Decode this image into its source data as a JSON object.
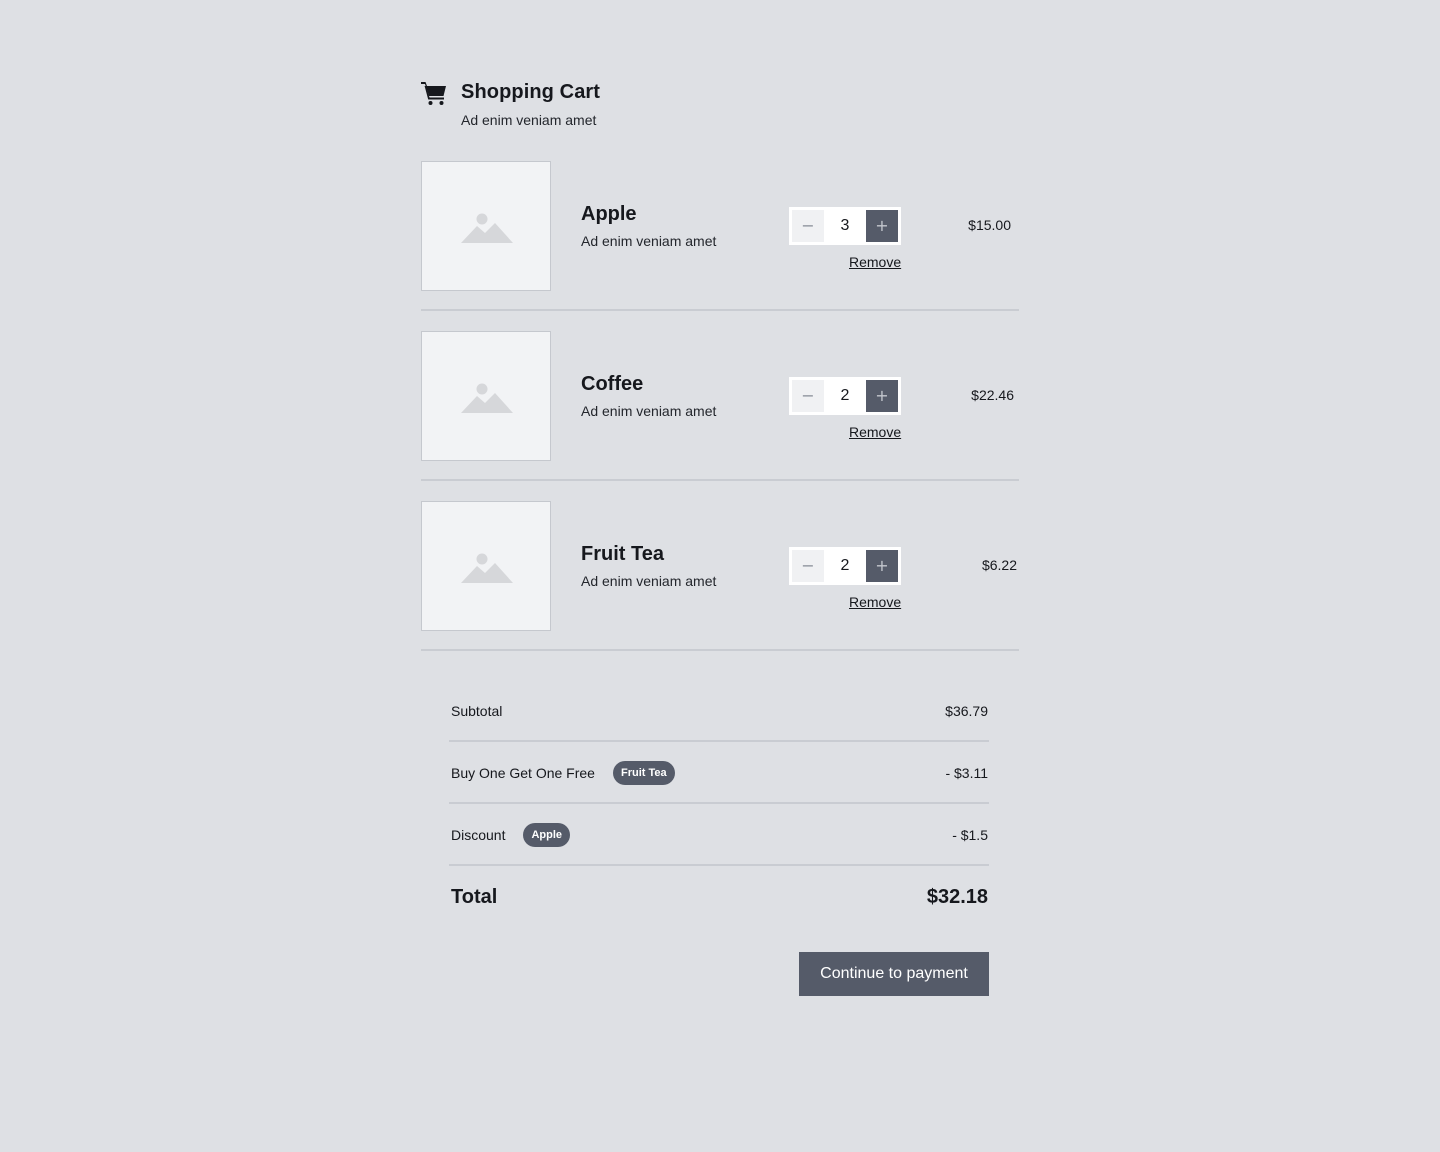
{
  "header": {
    "title": "Shopping Cart",
    "subtitle": "Ad enim veniam amet"
  },
  "items": [
    {
      "name": "Apple",
      "description": "Ad enim veniam amet",
      "quantity": "3",
      "price": "$15.00",
      "remove_label": "Remove",
      "decrement": "−",
      "increment": "+"
    },
    {
      "name": "Coffee",
      "description": "Ad enim veniam amet",
      "quantity": "2",
      "price": "$22.46",
      "remove_label": "Remove",
      "decrement": "−",
      "increment": "+"
    },
    {
      "name": "Fruit Tea",
      "description": "Ad enim veniam amet",
      "quantity": "2",
      "price": "$6.22",
      "remove_label": "Remove",
      "decrement": "−",
      "increment": "+"
    }
  ],
  "summary": {
    "subtotal_label": "Subtotal",
    "subtotal_value": "$36.79",
    "bogo_label": "Buy One Get One Free",
    "bogo_badge": "Fruit Tea",
    "bogo_value": "- $3.11",
    "discount_label": "Discount",
    "discount_badge": "Apple",
    "discount_value": "- $1.5",
    "total_label": "Total",
    "total_value": "$32.18"
  },
  "actions": {
    "pay_label": "Continue to payment"
  },
  "icons": {
    "cart": "shopping-cart-icon",
    "thumbnail": "image-placeholder-icon"
  },
  "colors": {
    "background": "#dee0e4",
    "accent": "#555b69",
    "text": "#16181d"
  }
}
